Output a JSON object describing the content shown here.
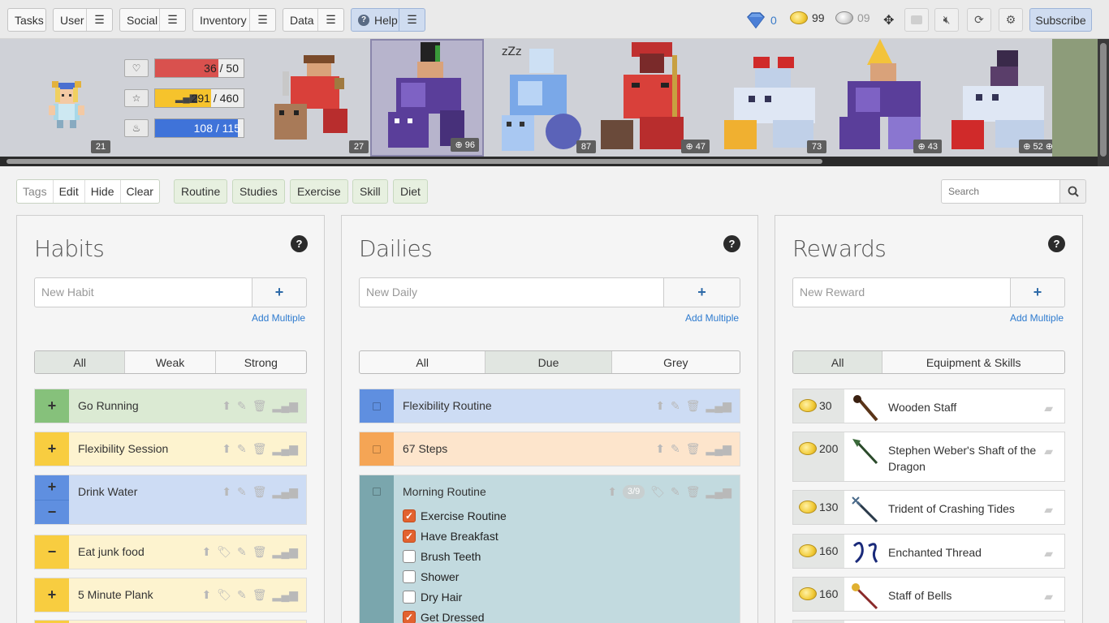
{
  "nav": {
    "tasks": "Tasks",
    "user": "User",
    "social": "Social",
    "inventory": "Inventory",
    "data": "Data",
    "help": "Help",
    "gems": "0",
    "gold": "99",
    "silver": "09",
    "subscribe": "Subscribe"
  },
  "user": {
    "level": "21",
    "hp": "36",
    "hp_max": "50",
    "hp_fraction": 0.72,
    "exp": "291",
    "exp_max": "460",
    "exp_fraction": 0.633,
    "mp": "108",
    "mp_max": "115",
    "mp_fraction": 0.939
  },
  "party": [
    {
      "level": "27"
    },
    {
      "level": "96"
    },
    {
      "level": "87"
    },
    {
      "level": "47"
    },
    {
      "level": "73"
    },
    {
      "level": "43"
    },
    {
      "level": "52"
    }
  ],
  "tags": {
    "tags": "Tags",
    "edit": "Edit",
    "hide": "Hide",
    "clear": "Clear",
    "routine": "Routine",
    "studies": "Studies",
    "exercise": "Exercise",
    "skill": "Skill",
    "diet": "Diet",
    "search_placeholder": "Search"
  },
  "habits": {
    "title": "Habits",
    "placeholder": "New Habit",
    "add_multiple": "Add Multiple",
    "filters": [
      "All",
      "Weak",
      "Strong"
    ],
    "items": [
      {
        "name": "Go Running"
      },
      {
        "name": "Flexibility Session"
      },
      {
        "name": "Drink Water"
      },
      {
        "name": "Eat junk food"
      },
      {
        "name": "5 Minute Plank"
      }
    ]
  },
  "dailies": {
    "title": "Dailies",
    "placeholder": "New Daily",
    "add_multiple": "Add Multiple",
    "filters": [
      "All",
      "Due",
      "Grey"
    ],
    "items": [
      {
        "name": "Flexibility Routine"
      },
      {
        "name": "67 Steps"
      },
      {
        "name": "Morning Routine",
        "progress": "3/9"
      }
    ],
    "checklist": [
      {
        "label": "Exercise Routine",
        "checked": true
      },
      {
        "label": "Have Breakfast",
        "checked": true
      },
      {
        "label": "Brush Teeth",
        "checked": false
      },
      {
        "label": "Shower",
        "checked": false
      },
      {
        "label": "Dry Hair",
        "checked": false
      },
      {
        "label": "Get Dressed",
        "checked": true
      }
    ]
  },
  "rewards": {
    "title": "Rewards",
    "placeholder": "New Reward",
    "add_multiple": "Add Multiple",
    "filters": [
      "All",
      "Equipment & Skills"
    ],
    "items": [
      {
        "price": "30",
        "name": "Wooden Staff"
      },
      {
        "price": "200",
        "name": "Stephen Weber's Shaft of the Dragon"
      },
      {
        "price": "130",
        "name": "Trident of Crashing Tides"
      },
      {
        "price": "160",
        "name": "Enchanted Thread"
      },
      {
        "price": "160",
        "name": "Staff of Bells"
      }
    ]
  }
}
